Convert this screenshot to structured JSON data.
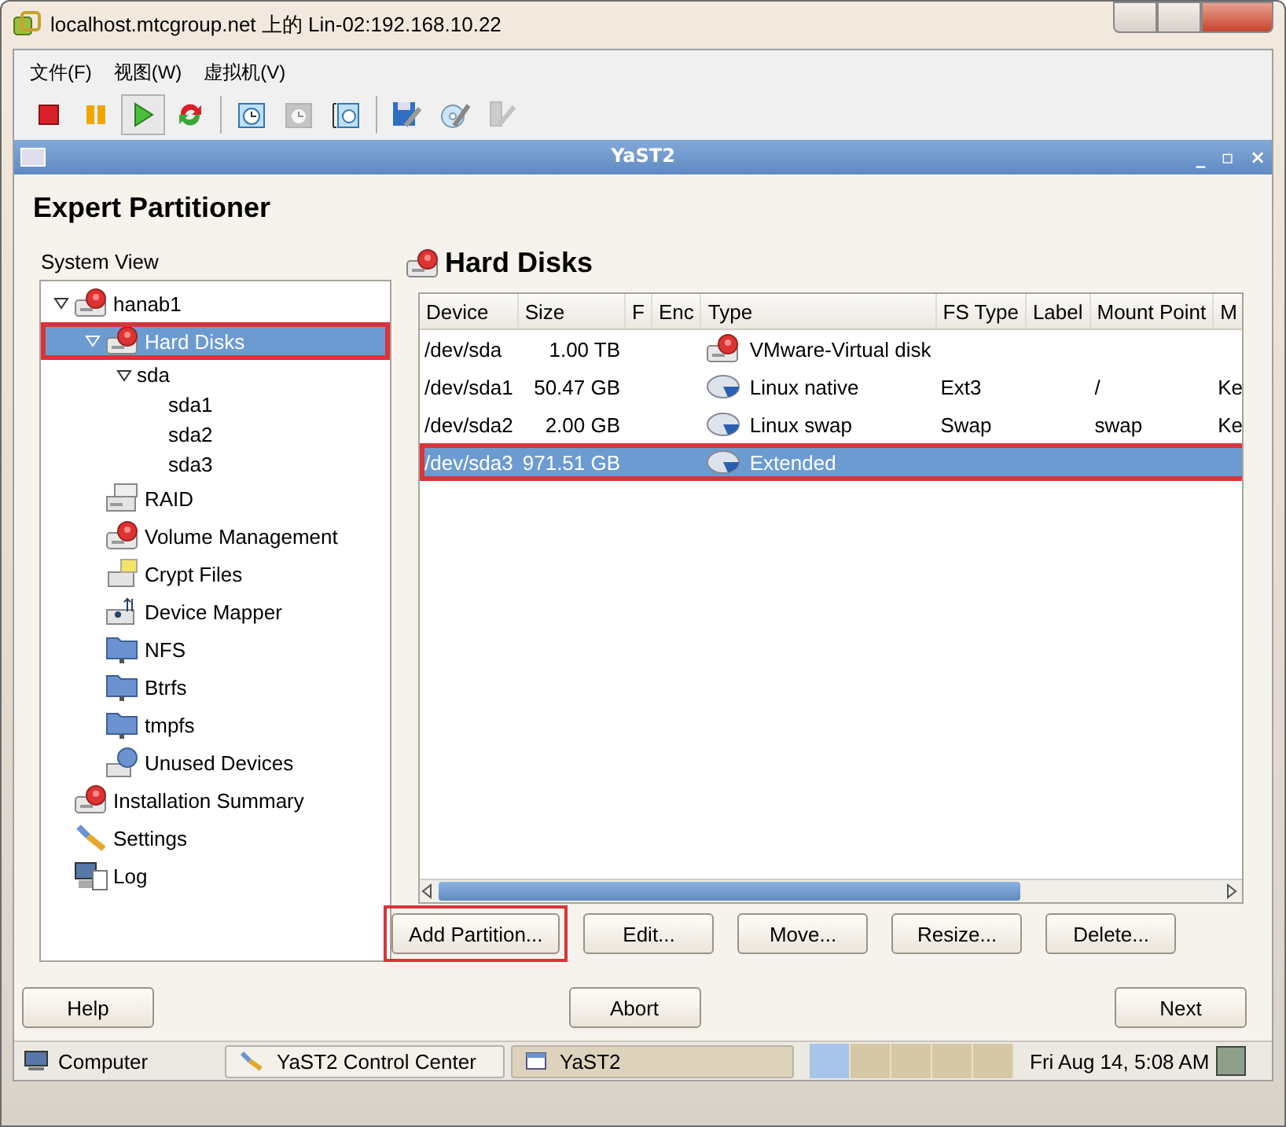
{
  "window": {
    "title": "localhost.mtcgroup.net 上的 Lin-02:192.168.10.22"
  },
  "menu": [
    "文件(F)",
    "视图(W)",
    "虚拟机(V)"
  ],
  "toolbar": [
    {
      "kind": "stop",
      "selected": false,
      "disabled": false
    },
    {
      "kind": "pause",
      "selected": false,
      "disabled": false
    },
    {
      "kind": "play",
      "selected": true,
      "disabled": false
    },
    {
      "kind": "refresh",
      "selected": false,
      "disabled": false
    },
    {
      "kind": "snapshot",
      "selected": false,
      "disabled": false
    },
    {
      "kind": "snapshot",
      "selected": false,
      "disabled": true
    },
    {
      "kind": "snapshotmanager",
      "selected": false,
      "disabled": false
    },
    {
      "kind": "diskedit",
      "selected": false,
      "disabled": false
    },
    {
      "kind": "discwrench",
      "selected": false,
      "disabled": false
    },
    {
      "kind": "usbwrench",
      "selected": false,
      "disabled": true
    }
  ],
  "yast_window": {
    "title": "YaST2",
    "controls": [
      "_",
      "▫",
      "×"
    ]
  },
  "heading": "Expert Partitioner",
  "system_view": {
    "label": "System View",
    "tree": [
      {
        "label": "hanab1",
        "kind": "disk",
        "expanded": true,
        "selected": false,
        "highlighted": false,
        "children": [
          {
            "label": "Hard Disks",
            "kind": "disk",
            "expanded": true,
            "selected": true,
            "highlighted": true,
            "children": [
              {
                "label": "sda",
                "expanded": true,
                "selected": false,
                "highlighted": false,
                "children": [
                  {
                    "label": "sda1",
                    "selected": false,
                    "highlighted": false
                  },
                  {
                    "label": "sda2",
                    "selected": false,
                    "highlighted": false
                  },
                  {
                    "label": "sda3",
                    "selected": false,
                    "highlighted": false
                  }
                ]
              }
            ]
          },
          {
            "label": "RAID",
            "kind": "raid",
            "selected": false,
            "highlighted": false
          },
          {
            "label": "Volume Management",
            "kind": "disk",
            "selected": false,
            "highlighted": false
          },
          {
            "label": "Crypt Files",
            "kind": "crypt",
            "selected": false,
            "highlighted": false
          },
          {
            "label": "Device Mapper",
            "kind": "mapper",
            "selected": false,
            "highlighted": false
          },
          {
            "label": "NFS",
            "kind": "folder",
            "selected": false,
            "highlighted": false
          },
          {
            "label": "Btrfs",
            "kind": "folder",
            "selected": false,
            "highlighted": false
          },
          {
            "label": "tmpfs",
            "kind": "folder",
            "selected": false,
            "highlighted": false
          },
          {
            "label": "Unused Devices",
            "kind": "unused",
            "selected": false,
            "highlighted": false
          }
        ]
      },
      {
        "label": "Installation Summary",
        "kind": "disk",
        "selected": false,
        "highlighted": false
      },
      {
        "label": "Settings",
        "kind": "settings",
        "selected": false,
        "highlighted": false
      },
      {
        "label": "Log",
        "kind": "log",
        "selected": false,
        "highlighted": false
      }
    ]
  },
  "panel": {
    "title": "Hard Disks",
    "table": {
      "columns": [
        "Device",
        "Size",
        "F",
        "Enc",
        "Type",
        "FS Type",
        "Label",
        "Mount Point",
        "M"
      ],
      "rows": [
        {
          "selected": false,
          "highlighted": false,
          "kind": "disk",
          "cells": [
            "/dev/sda",
            "1.00 TB",
            "",
            "",
            "VMware-Virtual disk",
            "",
            "",
            "",
            ""
          ]
        },
        {
          "selected": false,
          "highlighted": false,
          "kind": "partition",
          "cells": [
            "/dev/sda1",
            "50.47 GB",
            "",
            "",
            "Linux native",
            "Ext3",
            "",
            "/",
            "Ke"
          ]
        },
        {
          "selected": false,
          "highlighted": false,
          "kind": "partition",
          "cells": [
            "/dev/sda2",
            "2.00 GB",
            "",
            "",
            "Linux swap",
            "Swap",
            "",
            "swap",
            "Ke"
          ]
        },
        {
          "selected": true,
          "highlighted": true,
          "kind": "partition",
          "cells": [
            "/dev/sda3",
            "971.51 GB",
            "",
            "",
            "Extended",
            "",
            "",
            "",
            ""
          ]
        }
      ]
    },
    "buttons": [
      {
        "label": "Add Partition...",
        "highlighted": true
      },
      {
        "label": "Edit...",
        "highlighted": false
      },
      {
        "label": "Move...",
        "highlighted": false
      },
      {
        "label": "Resize...",
        "highlighted": false
      },
      {
        "label": "Delete...",
        "highlighted": false
      }
    ]
  },
  "footer_buttons": [
    "Help",
    "Abort",
    "Next"
  ],
  "taskbar": {
    "computer": "Computer",
    "tasks": [
      {
        "label": "YaST2 Control Center",
        "kind": "wrench",
        "selected": false
      },
      {
        "label": "YaST2",
        "kind": "window",
        "selected": true
      }
    ],
    "clock": "Fri Aug 14,  5:08 AM"
  }
}
